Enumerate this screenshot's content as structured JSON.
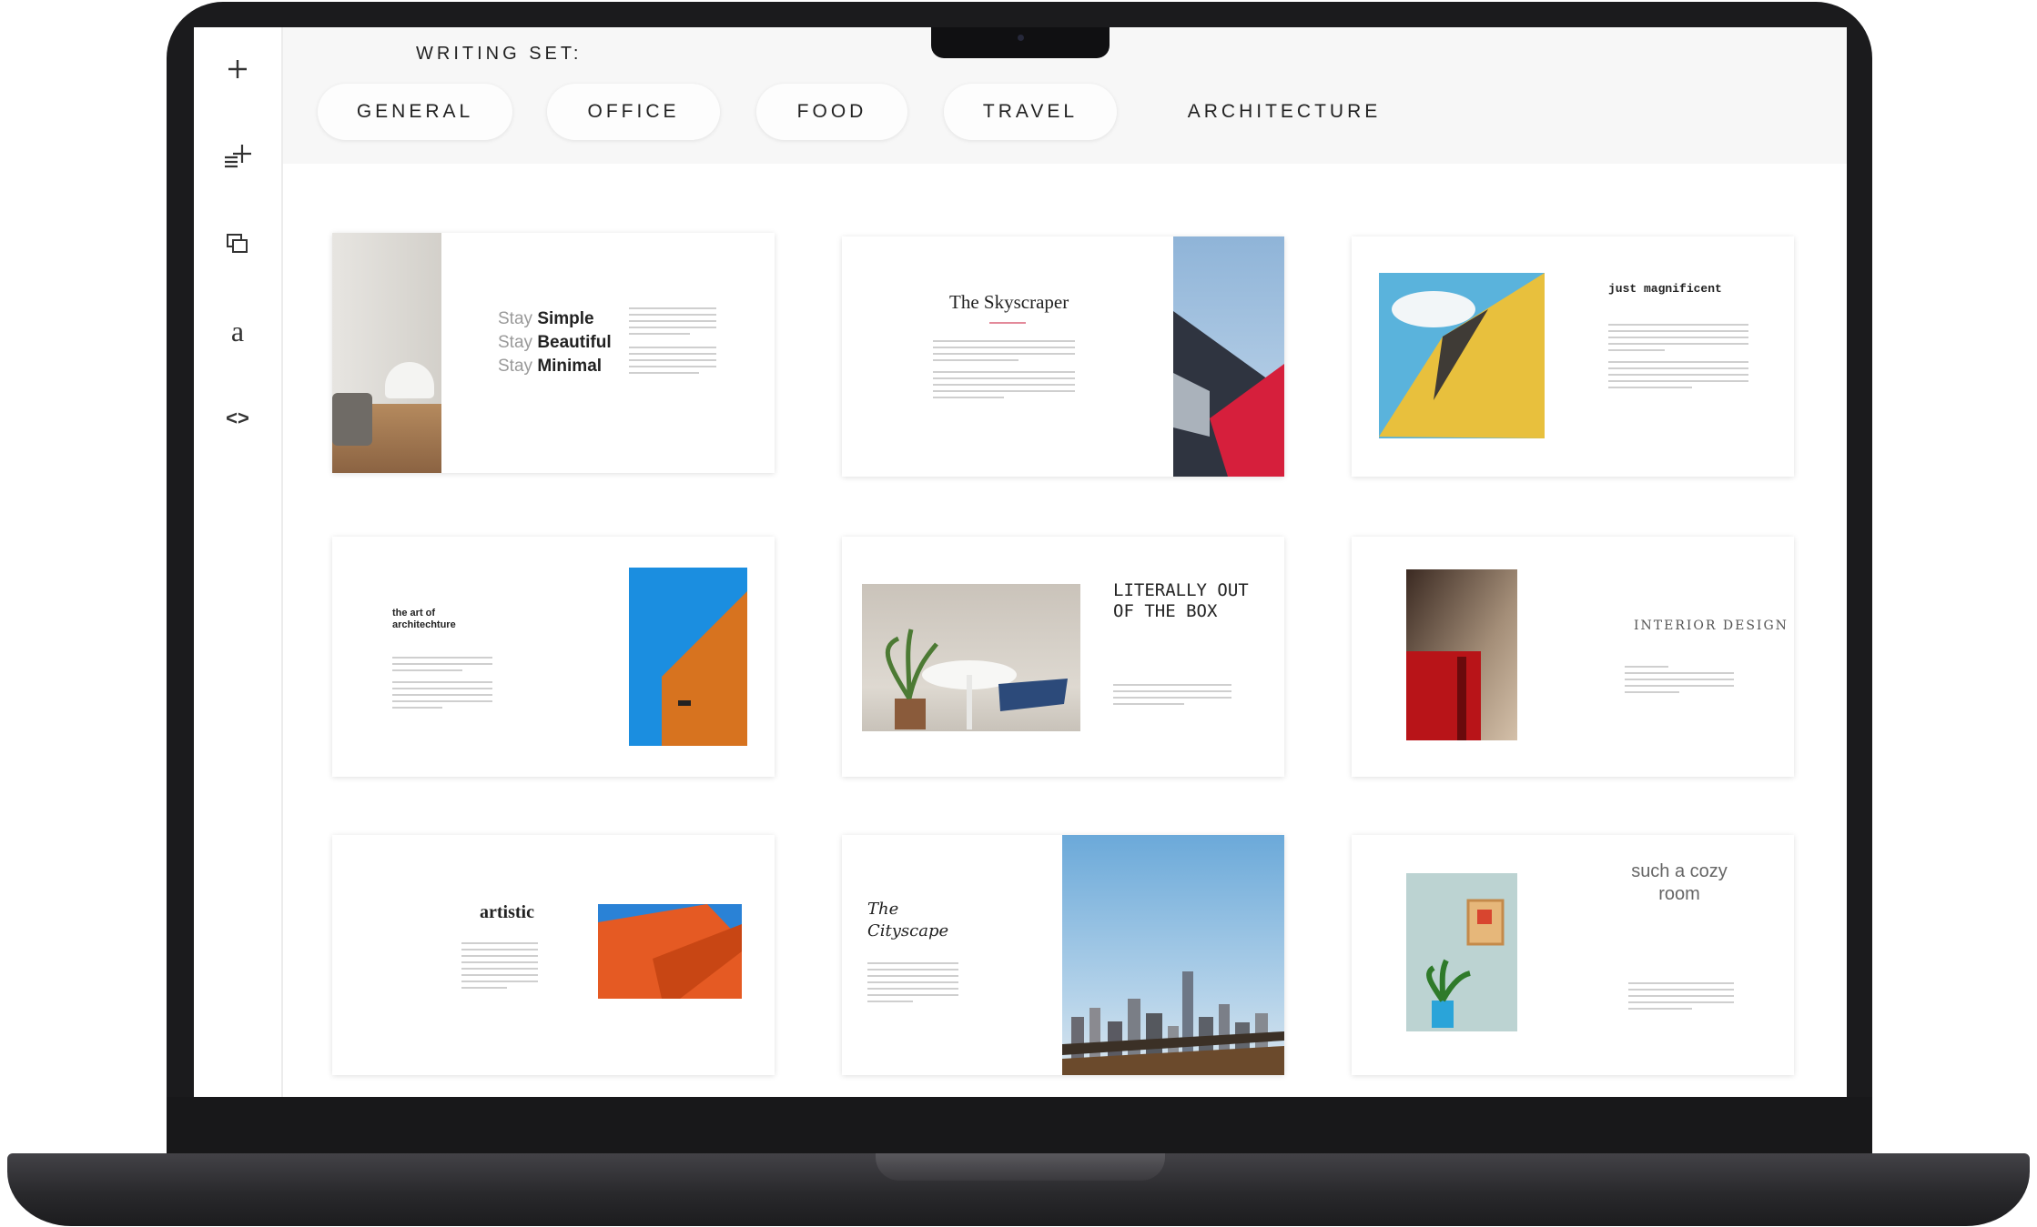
{
  "header": {
    "set_label": "WRITING SET:",
    "tabs": [
      {
        "label": "GENERAL"
      },
      {
        "label": "OFFICE"
      },
      {
        "label": "FOOD"
      },
      {
        "label": "TRAVEL"
      },
      {
        "label": "ARCHITECTURE"
      }
    ]
  },
  "sidebar": {
    "items": [
      {
        "icon": "plus-icon"
      },
      {
        "icon": "add-list-icon"
      },
      {
        "icon": "duplicate-icon"
      },
      {
        "icon": "font-icon",
        "glyph": "a"
      },
      {
        "icon": "code-icon",
        "glyph": "<>"
      }
    ]
  },
  "templates": [
    {
      "lines": [
        {
          "prefix": "Stay ",
          "bold": "Simple"
        },
        {
          "prefix": "Stay ",
          "bold": "Beautiful"
        },
        {
          "prefix": "Stay ",
          "bold": "Minimal"
        }
      ]
    },
    {
      "title": "The Skyscraper"
    },
    {
      "title": "just magnificent"
    },
    {
      "title": "the art of architechture"
    },
    {
      "title": "LITERALLY OUT OF THE BOX"
    },
    {
      "title": "INTERIOR DESIGN"
    },
    {
      "title": "artistic"
    },
    {
      "title": "The Cityscape"
    },
    {
      "title": "such a cozy room"
    }
  ]
}
